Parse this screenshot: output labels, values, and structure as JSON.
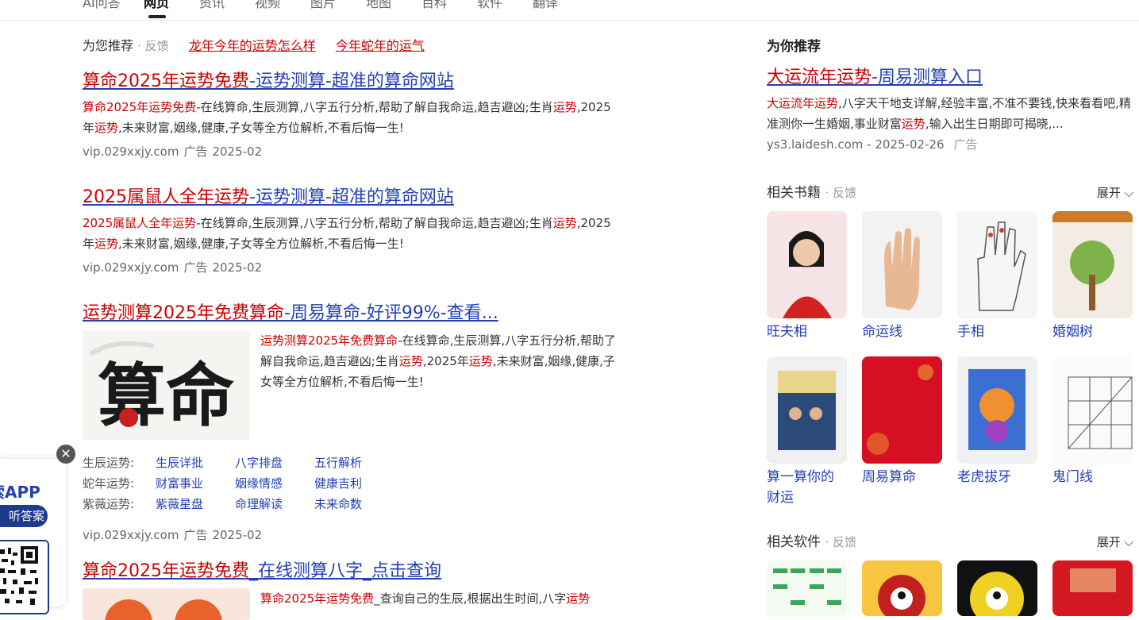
{
  "tabs": [
    "AI问答",
    "网页",
    "资讯",
    "视频",
    "图片",
    "地图",
    "百科",
    "软件",
    "翻译"
  ],
  "recommend": {
    "label": "为您推荐",
    "feedback": "· 反馈",
    "links": [
      "龙年今年的运势怎么样",
      "今年蛇年的运气"
    ]
  },
  "results": [
    {
      "title_red": "算命2025年运势免费",
      "title_rest": "-运势测算-超准的算命网站",
      "desc_red": "算命2025年运势免费",
      "desc_1": "-在线算命,生辰测算,八字五行分析,帮助了解自我命运,趋吉避凶;生肖",
      "desc_red2": "运势",
      "desc_2": ",2025年",
      "desc_red3": "运势",
      "desc_3": ",未来财富,姻缘,健康,子女等全方位解析,不看后悔一生!",
      "url": "vip.029xxjy.com",
      "ad": "广告",
      "date": "2025-02"
    },
    {
      "title_red": "2025属鼠人全年运势",
      "title_rest": "-运势测算-超准的算命网站",
      "desc_red": "2025属鼠人全年运势",
      "desc_1": "-在线算命,生辰测算,八字五行分析,帮助了解自我命运,趋吉避凶;生肖",
      "desc_red2": "运势",
      "desc_2": ",2025年",
      "desc_red3": "运势",
      "desc_3": ",未来财富,姻缘,健康,子女等全方位解析,不看后悔一生!",
      "url": "vip.029xxjy.com",
      "ad": "广告",
      "date": "2025-02"
    },
    {
      "title_red": "运势测算2025年免费算命",
      "title_rest": "-周易算命-好评99%-查看...",
      "image_text": "算命",
      "desc_red": "运势测算2025年免费算命",
      "desc_1": "-在线算命,生辰测算,八字五行分析,帮助了解自我命运,趋吉避凶;生肖",
      "desc_red2": "运势",
      "desc_2": ",2025年",
      "desc_red3": "运势",
      "desc_3": ",未来财富,姻缘,健康,子女等全方位解析,不看后悔一生!",
      "sublinks": [
        {
          "key": "生辰运势:",
          "links": [
            "生辰详批",
            "八字排盘",
            "五行解析"
          ]
        },
        {
          "key": "蛇年运势:",
          "links": [
            "财富事业",
            "姻缘情感",
            "健康吉利"
          ]
        },
        {
          "key": "紫薇运势:",
          "links": [
            "紫薇星盘",
            "命理解读",
            "未来命数"
          ]
        }
      ],
      "url": "vip.029xxjy.com",
      "ad": "广告",
      "date": "2025-02"
    },
    {
      "title_red": "算命2025年运势免费",
      "title_rest": "_在线测算八字_点击查询",
      "desc_red": "算命2025年运势免费",
      "desc_1": "_查询自己的生辰,根据出生时间,八字",
      "desc_red2": "运势"
    }
  ],
  "app": {
    "title": "索APP",
    "button": "听答案"
  },
  "right": {
    "heading": "为你推荐",
    "ad_title_red": "大运流年运势",
    "ad_title_rest": "-周易测算入口",
    "ad_desc_red": "大运流年运势",
    "ad_desc_1": ",八字天干地支详解,经验丰富,不准不要钱,快来看看吧,精准测你一生婚姻,事业财富",
    "ad_desc_red2": "运势",
    "ad_desc_2": ",输入出生日期即可揭晓,...",
    "ad_url": "ys3.laidesh.com - 2025-02-26",
    "ad_tag": "广告",
    "books_title": "相关书籍",
    "books_feedback": "· 反馈",
    "expand": "展开",
    "books": [
      "旺夫相",
      "命运线",
      "手相",
      "婚姻树",
      "算一算你的财运",
      "周易算命",
      "老虎拔牙",
      "鬼门线"
    ],
    "software_title": "相关软件",
    "software_feedback": "· 反馈",
    "software_expand": "展开"
  },
  "colors": {
    "link_blue": "#2440b3",
    "keyword_red": "#cc0000",
    "app_blue": "#1e3a8a"
  }
}
